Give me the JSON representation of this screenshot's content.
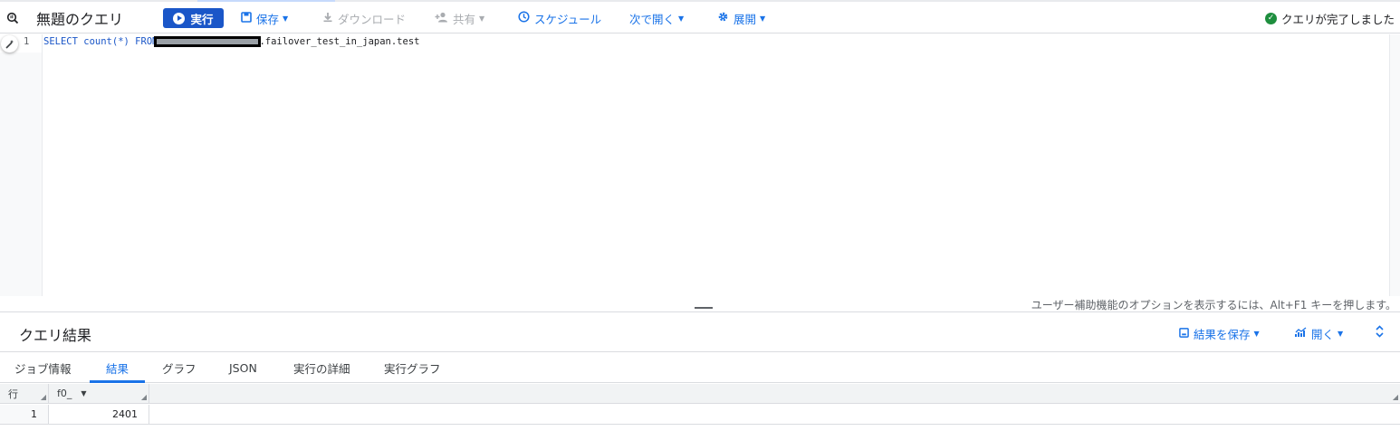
{
  "toolbar": {
    "title": "無題のクエリ",
    "run_label": "実行",
    "save_label": "保存",
    "download_label": "ダウンロード",
    "share_label": "共有",
    "schedule_label": "スケジュール",
    "open_next_label": "次で開く",
    "expand_label": "展開",
    "status_text": "クエリが完了しました"
  },
  "editor": {
    "line_number": "1",
    "code": {
      "keyword_select": "SELECT",
      "func": "count(*)",
      "keyword_from": "FROM",
      "table_suffix": ".failover_test_in_japan.test"
    },
    "accessibility_hint": "ユーザー補助機能のオプションを表示するには、Alt+F1 キーを押します。"
  },
  "results": {
    "title": "クエリ結果",
    "save_results_label": "結果を保存",
    "open_label": "開く",
    "tabs": [
      "ジョブ情報",
      "結果",
      "グラフ",
      "JSON",
      "実行の詳細",
      "実行グラフ"
    ],
    "active_tab": "結果",
    "table": {
      "row_header": "行",
      "columns": [
        "f0_"
      ],
      "rows": [
        {
          "row": "1",
          "f0_": "2401"
        }
      ]
    }
  },
  "colors": {
    "accent": "#1a73e8",
    "run_button": "#1a56c8",
    "success": "#1e8e3e"
  }
}
